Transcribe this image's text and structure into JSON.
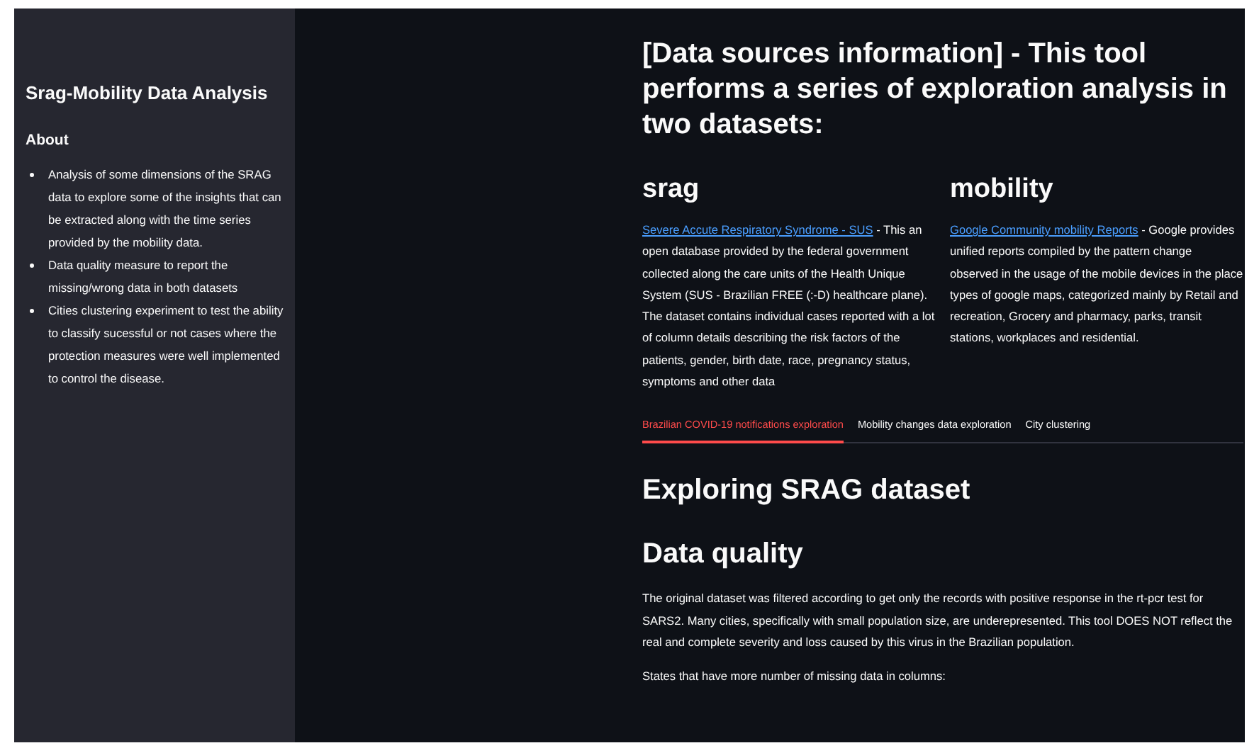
{
  "sidebar": {
    "title": "Srag-Mobility Data Analysis",
    "about_heading": "About",
    "items": [
      "Analysis of some dimensions of the SRAG data to explore some of the insights that can be extracted along with the time series provided by the mobility data.",
      "Data quality measure to report the missing/wrong data in both datasets",
      "Cities clustering experiment to test the ability to classify sucessful or not cases where the protection measures were well implemented to control the disease."
    ]
  },
  "main": {
    "heading": "[Data sources information] - This tool performs a series of exploration analysis in two datasets:",
    "sources": [
      {
        "title": "srag",
        "link": "Severe Accute Respiratory Syndrome - SUS",
        "text": " - This an open database provided by the federal government collected along the care units of the Health Unique System (SUS - Brazilian FREE (:-D) healthcare plane). The dataset contains individual cases reported with a lot of column details describing the risk factors of the patients, gender, birth date, race, pregnancy status, symptoms and other data"
      },
      {
        "title": "mobility",
        "link": "Google Community mobility Reports",
        "text": " - Google provides unified reports compiled by the pattern change observed in the usage of the mobile devices in the place types of google maps, categorized mainly by Retail and recreation, Grocery and pharmacy, parks, transit stations, workplaces and residential."
      }
    ],
    "tabs": [
      {
        "label": "Brazilian COVID-19 notifications exploration",
        "selected": true
      },
      {
        "label": "Mobility changes data exploration",
        "selected": false
      },
      {
        "label": "City clustering",
        "selected": false
      }
    ],
    "section_title": "Exploring SRAG dataset",
    "subsection_title": "Data quality",
    "paragraphs": [
      "The original dataset was filtered according to get only the records with positive response in the rt-pcr test for SARS2. Many cities, specifically with small population size, are underepresented. This tool DOES NOT reflect the real and complete severity and loss caused by this virus in the Brazilian population.",
      "States that have more number of missing data in columns:"
    ]
  }
}
